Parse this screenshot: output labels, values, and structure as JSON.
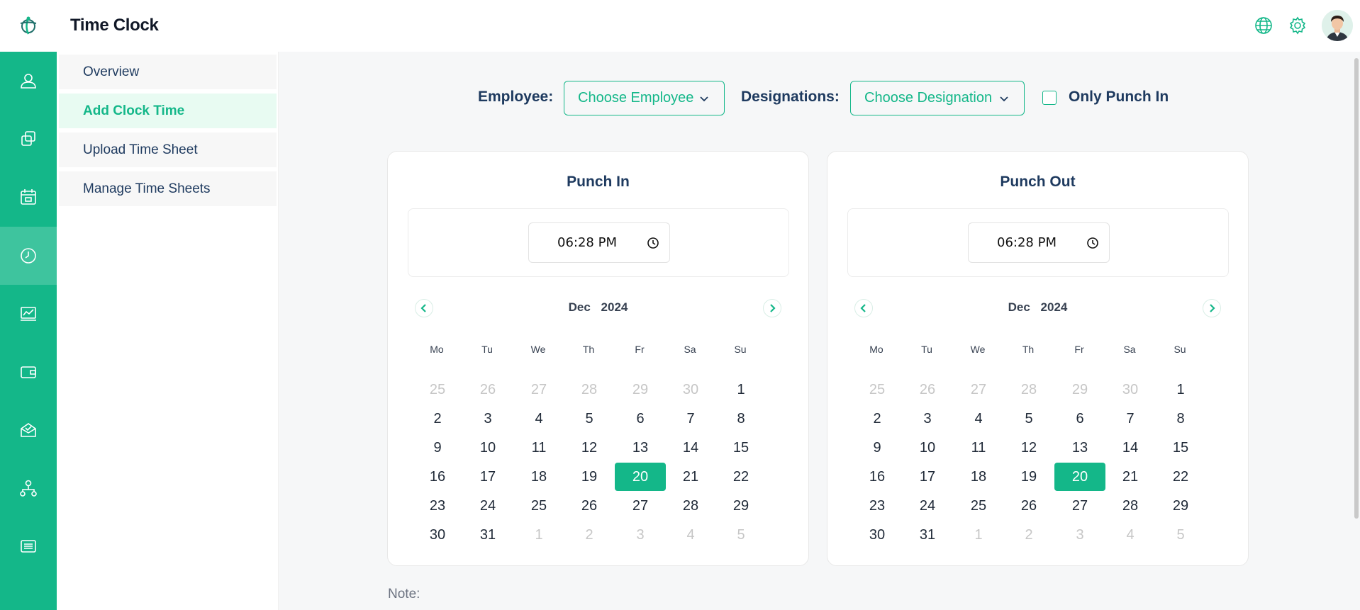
{
  "header": {
    "title": "Time Clock"
  },
  "rail": {
    "icons": [
      "user-icon",
      "copy-icon",
      "calendar-icon",
      "clock-icon",
      "chart-icon",
      "wallet-icon",
      "inbox-icon",
      "org-chart-icon",
      "list-icon"
    ],
    "active": "clock-icon"
  },
  "top_icons": [
    "globe-icon",
    "gear-icon",
    "avatar"
  ],
  "subnav": {
    "items": [
      {
        "label": "Overview"
      },
      {
        "label": "Add Clock Time"
      },
      {
        "label": "Upload Time Sheet"
      },
      {
        "label": "Manage Time Sheets"
      }
    ],
    "active_index": 1
  },
  "filters": {
    "employee_label": "Employee:",
    "employee_value": "Choose Employee",
    "designation_label": "Designations:",
    "designation_value": "Choose Designation",
    "only_punch_in_label": "Only Punch In",
    "only_punch_in_checked": false
  },
  "punch_in": {
    "title": "Punch In",
    "time": "06:28 PM",
    "month": "Dec",
    "year": "2024",
    "selected_day": 20
  },
  "punch_out": {
    "title": "Punch Out",
    "time": "06:28 PM",
    "month": "Dec",
    "year": "2024",
    "selected_day": 20
  },
  "calendar": {
    "weekdays": [
      "Mo",
      "Tu",
      "We",
      "Th",
      "Fr",
      "Sa",
      "Su"
    ],
    "weeks": [
      [
        "25",
        "26",
        "27",
        "28",
        "29",
        "30",
        "1"
      ],
      [
        "2",
        "3",
        "4",
        "5",
        "6",
        "7",
        "8"
      ],
      [
        "9",
        "10",
        "11",
        "12",
        "13",
        "14",
        "15"
      ],
      [
        "16",
        "17",
        "18",
        "19",
        "20",
        "21",
        "22"
      ],
      [
        "23",
        "24",
        "25",
        "26",
        "27",
        "28",
        "29"
      ],
      [
        "30",
        "31",
        "1",
        "2",
        "3",
        "4",
        "5"
      ]
    ],
    "muted": [
      [
        0,
        0
      ],
      [
        0,
        1
      ],
      [
        0,
        2
      ],
      [
        0,
        3
      ],
      [
        0,
        4
      ],
      [
        0,
        5
      ],
      [
        5,
        2
      ],
      [
        5,
        3
      ],
      [
        5,
        4
      ],
      [
        5,
        5
      ],
      [
        5,
        6
      ]
    ],
    "selected": [
      3,
      4
    ]
  },
  "note": {
    "label": "Note:"
  },
  "colors": {
    "accent": "#14b789",
    "text_dark": "#1e3a5f"
  }
}
